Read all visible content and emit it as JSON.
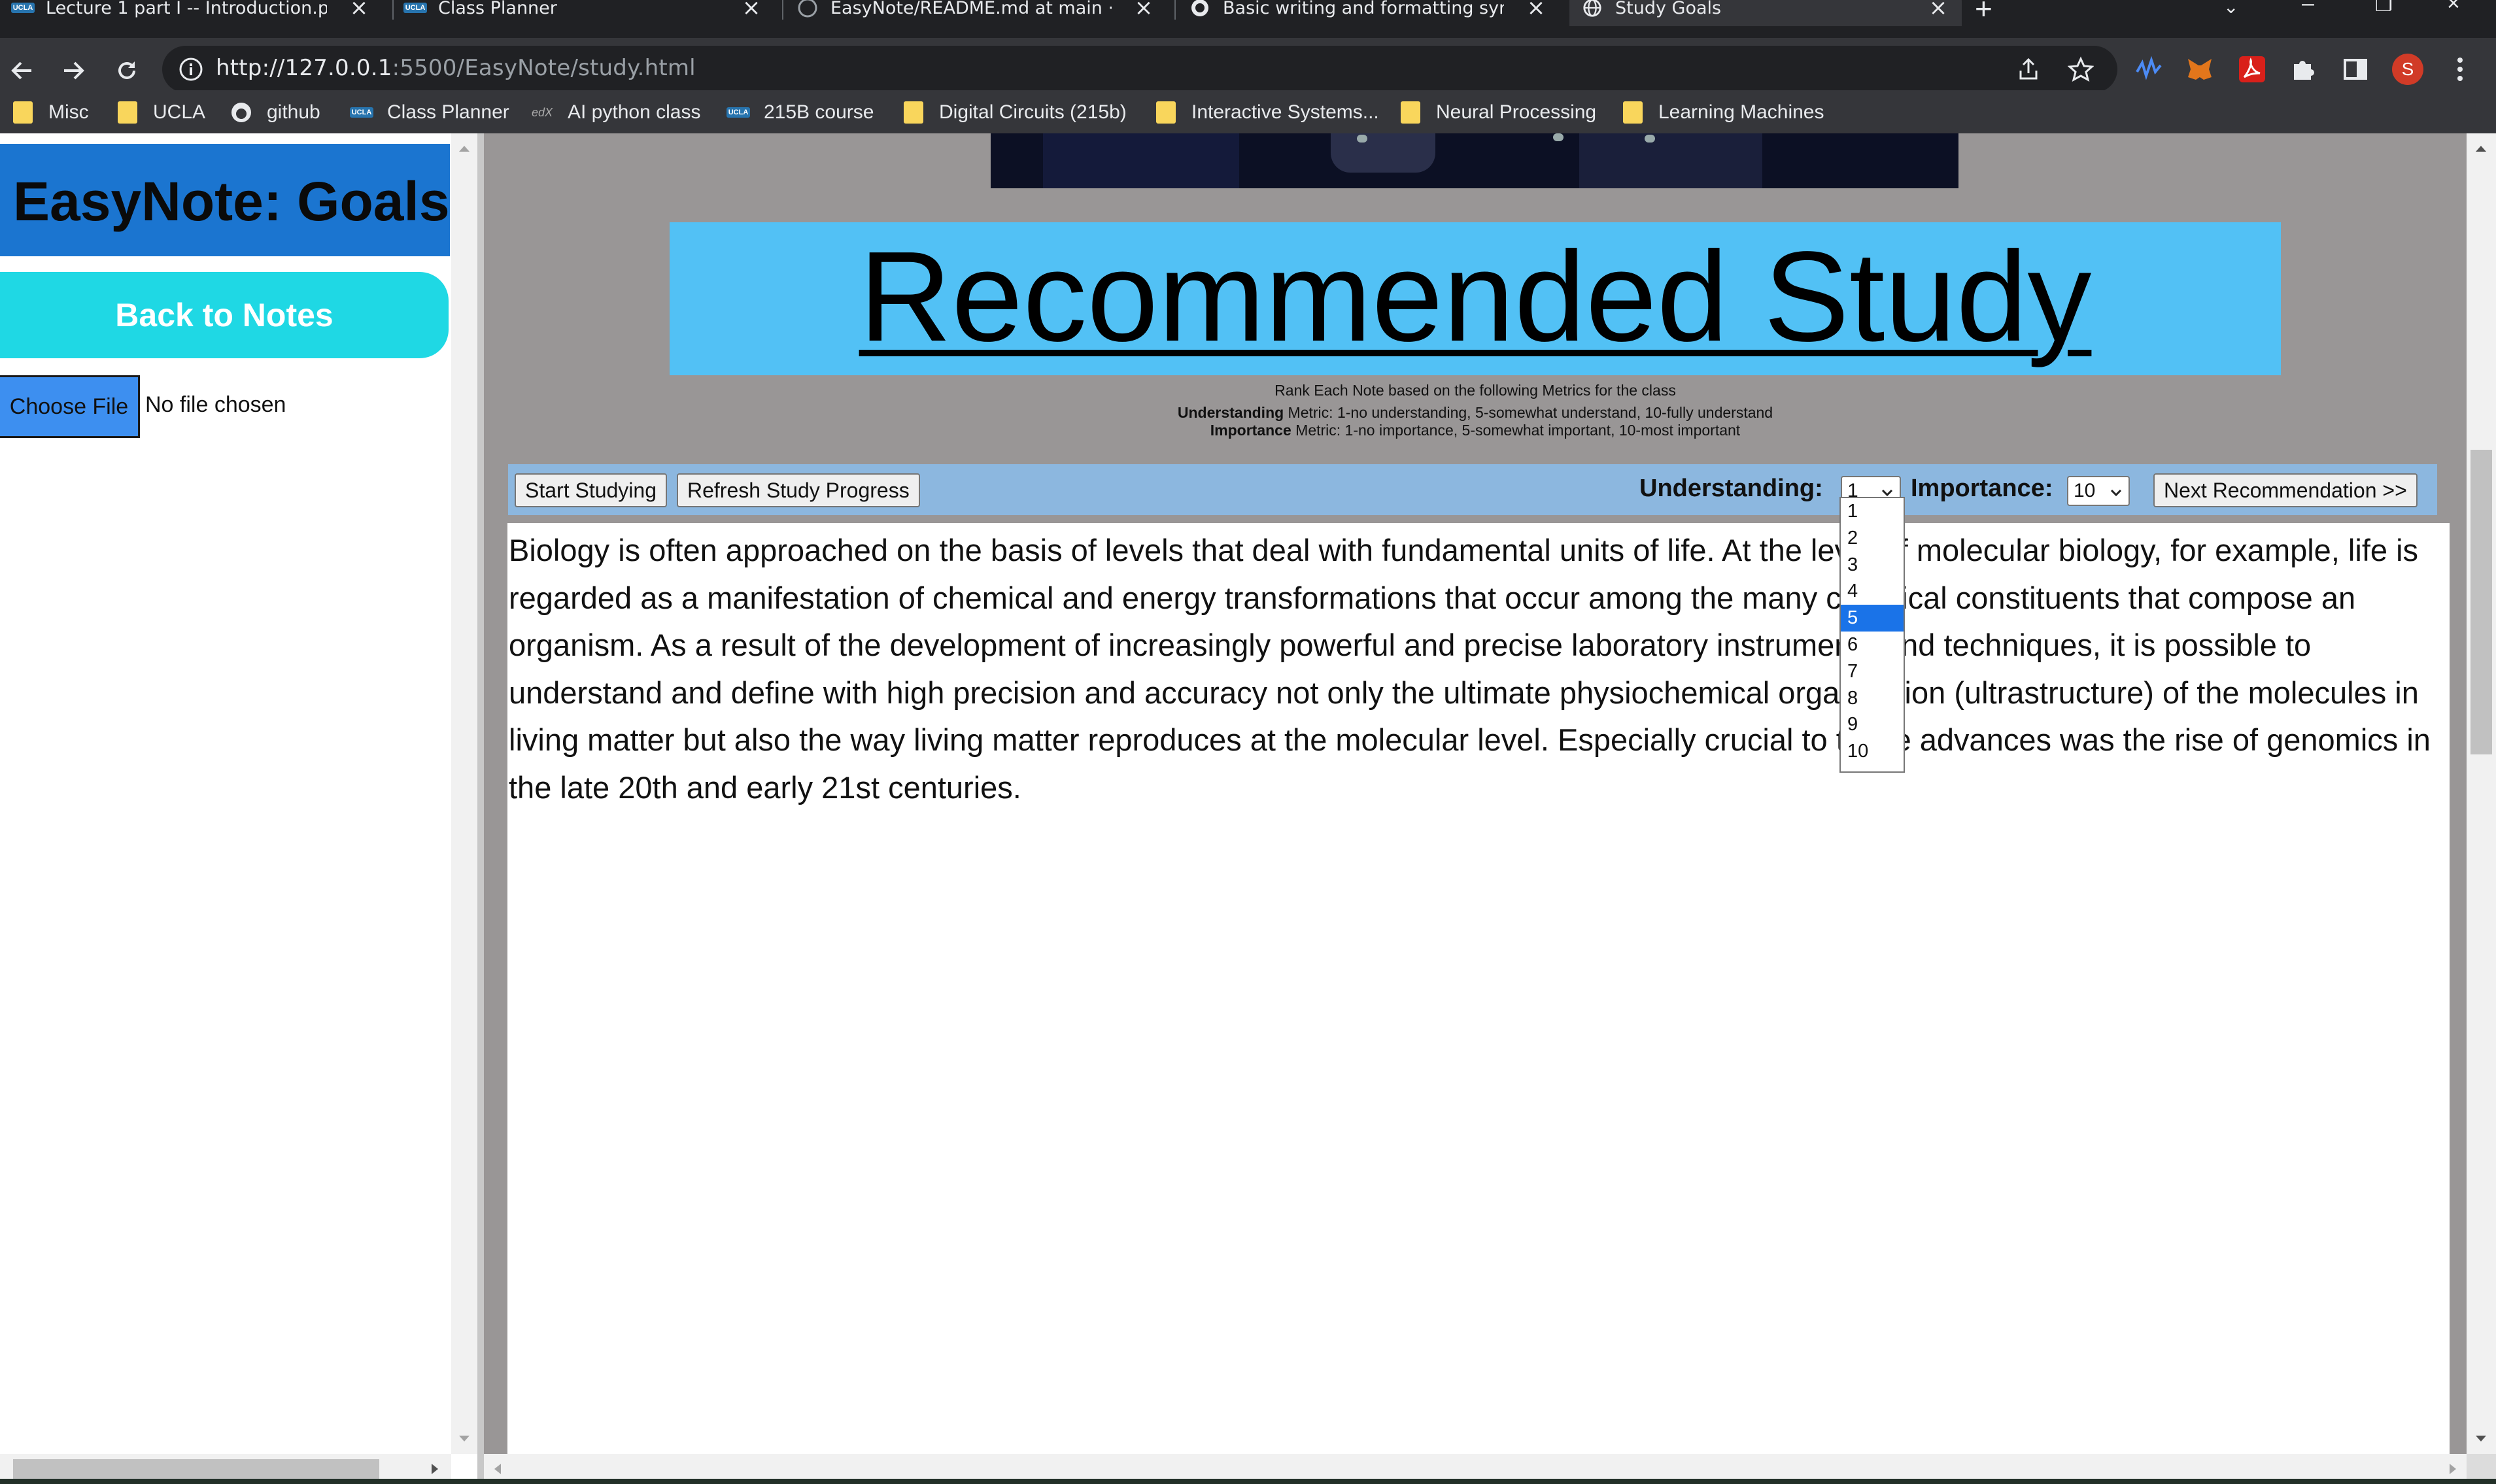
{
  "browser": {
    "tabs": [
      {
        "title": "Lecture 1 part I -- Introduction.pd",
        "icon": "ucla-badge",
        "active": false
      },
      {
        "title": "Class Planner",
        "icon": "ucla-badge",
        "active": false
      },
      {
        "title": "EasyNote/README.md at main ·",
        "icon": "github-icon",
        "active": false
      },
      {
        "title": "Basic writing and formatting synt",
        "icon": "github-icon",
        "active": false
      },
      {
        "title": "Study Goals",
        "icon": "globe-icon",
        "active": true
      }
    ],
    "ucla_badge_text": "UCLA",
    "url_host": "http://127.0.0.1",
    "url_rest": ":5500/EasyNote/study.html",
    "profile_initial": "S",
    "bookmarks": [
      {
        "label": "Misc",
        "icon": "folder-icon"
      },
      {
        "label": "UCLA",
        "icon": "folder-icon"
      },
      {
        "label": "github",
        "icon": "github-icon"
      },
      {
        "label": "Class Planner",
        "icon": "ucla-badge"
      },
      {
        "label": "AI python class",
        "icon": "edx-icon"
      },
      {
        "label": "215B course",
        "icon": "ucla-badge"
      },
      {
        "label": "Digital Circuits (215b)",
        "icon": "folder-icon"
      },
      {
        "label": "Interactive Systems...",
        "icon": "folder-icon"
      },
      {
        "label": "Neural Processing",
        "icon": "folder-icon"
      },
      {
        "label": "Learning Machines",
        "icon": "folder-icon"
      }
    ],
    "edx_text": "edX"
  },
  "sidebar": {
    "title": "EasyNote: Goals",
    "back_button": "Back to Notes",
    "choose_file": "Choose File",
    "no_file": "No file chosen"
  },
  "main": {
    "heading": "Recommended Study",
    "instructions": "Rank Each Note based on the following Metrics for the class",
    "understanding_bold": "Understanding",
    "understanding_text": " Metric: 1-no understanding, 5-somewhat understand, 10-fully understand",
    "importance_bold": "Importance",
    "importance_text": " Metric: 1-no importance, 5-somewhat important, 10-most important",
    "start_button": "Start Studying",
    "refresh_button": "Refresh Study Progress",
    "understanding_label": "Understanding:",
    "understanding_value": "1",
    "importance_label": "Importance:",
    "importance_value": "10",
    "next_button": "Next Recommendation >>",
    "dropdown_options": [
      "1",
      "2",
      "3",
      "4",
      "5",
      "6",
      "7",
      "8",
      "9",
      "10"
    ],
    "dropdown_highlighted": "5",
    "note_text": "Biology is often approached on the basis of levels that deal with fundamental units of life. At the level of molecular biology, for example, life is regarded as a manifestation of chemical and energy transformations that occur among the many chemical constituents that compose an organism. As a result of the development of increasingly powerful and precise laboratory instruments and techniques, it is possible to understand and define with high precision and accuracy not only the ultimate physiochemical organization (ultrastructure) of the molecules in living matter but also the way living matter reproduces at the molecular level. Especially crucial to those advances was the rise of genomics in the late 20th and early 21st centuries."
  },
  "colors": {
    "sidebar_title_bg": "#1b75d0",
    "back_button_bg": "#1fd8e4",
    "choose_file_bg": "#3d8ff0",
    "page_bg": "#999696",
    "banner_bg": "#52c1f5",
    "controls_bg": "#8cb7df",
    "dropdown_highlight": "#1a73e8"
  }
}
